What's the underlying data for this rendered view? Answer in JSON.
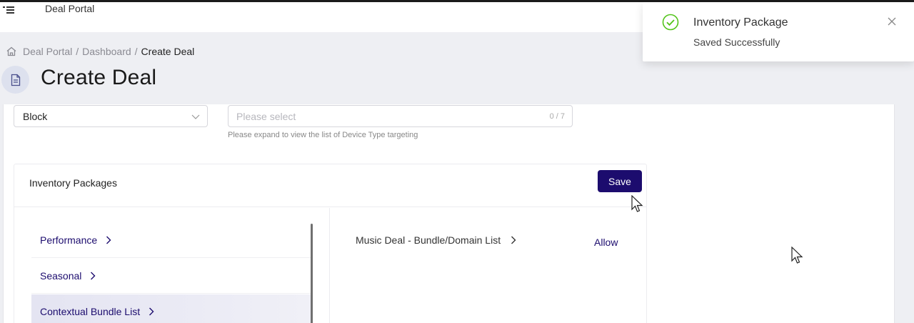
{
  "app": {
    "title": "Deal Portal"
  },
  "icons": {
    "menu": "menu-icon",
    "home": "home-icon",
    "page": "document-icon",
    "select_arrow": "chevron-down-icon",
    "list_arrow": "chevron-right-icon",
    "toast_status": "check-circle-icon",
    "toast_close": "close-icon"
  },
  "breadcrumb": {
    "items": [
      "Deal Portal",
      "Dashboard"
    ],
    "separator": "/",
    "current": "Create Deal"
  },
  "page": {
    "title": "Create Deal"
  },
  "form": {
    "block_select": {
      "value": "Block"
    },
    "device_select": {
      "placeholder": "Please select",
      "count": "0 / 7",
      "helper": "Please expand to view the list of Device Type targeting"
    }
  },
  "inventory": {
    "title": "Inventory Packages",
    "save_label": "Save",
    "categories": [
      {
        "label": "Performance",
        "active": false
      },
      {
        "label": "Seasonal",
        "active": false
      },
      {
        "label": "Contextual Bundle List",
        "active": true
      }
    ],
    "package": {
      "label": "Music Deal - Bundle/Domain List",
      "action": "Allow"
    }
  },
  "toast": {
    "title": "Inventory Package",
    "message": "Saved Successfully"
  },
  "colors": {
    "primary": "#1c0c6e",
    "success": "#52c41a",
    "background": "#eeeff3"
  }
}
